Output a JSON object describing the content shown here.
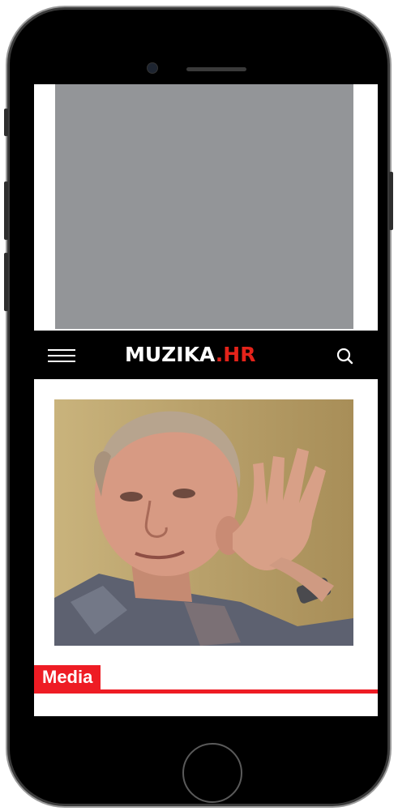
{
  "brand": {
    "name_main": "MUZIKA",
    "name_suffix": ".HR",
    "accent_color": "#e3231a"
  },
  "header": {
    "menu_icon": "hamburger-menu-icon",
    "search_icon": "search-icon"
  },
  "advert": {
    "placeholder_color": "#939598"
  },
  "article": {
    "image_description_icon": "photo",
    "category": "Media",
    "category_color": "#ee1c24"
  }
}
